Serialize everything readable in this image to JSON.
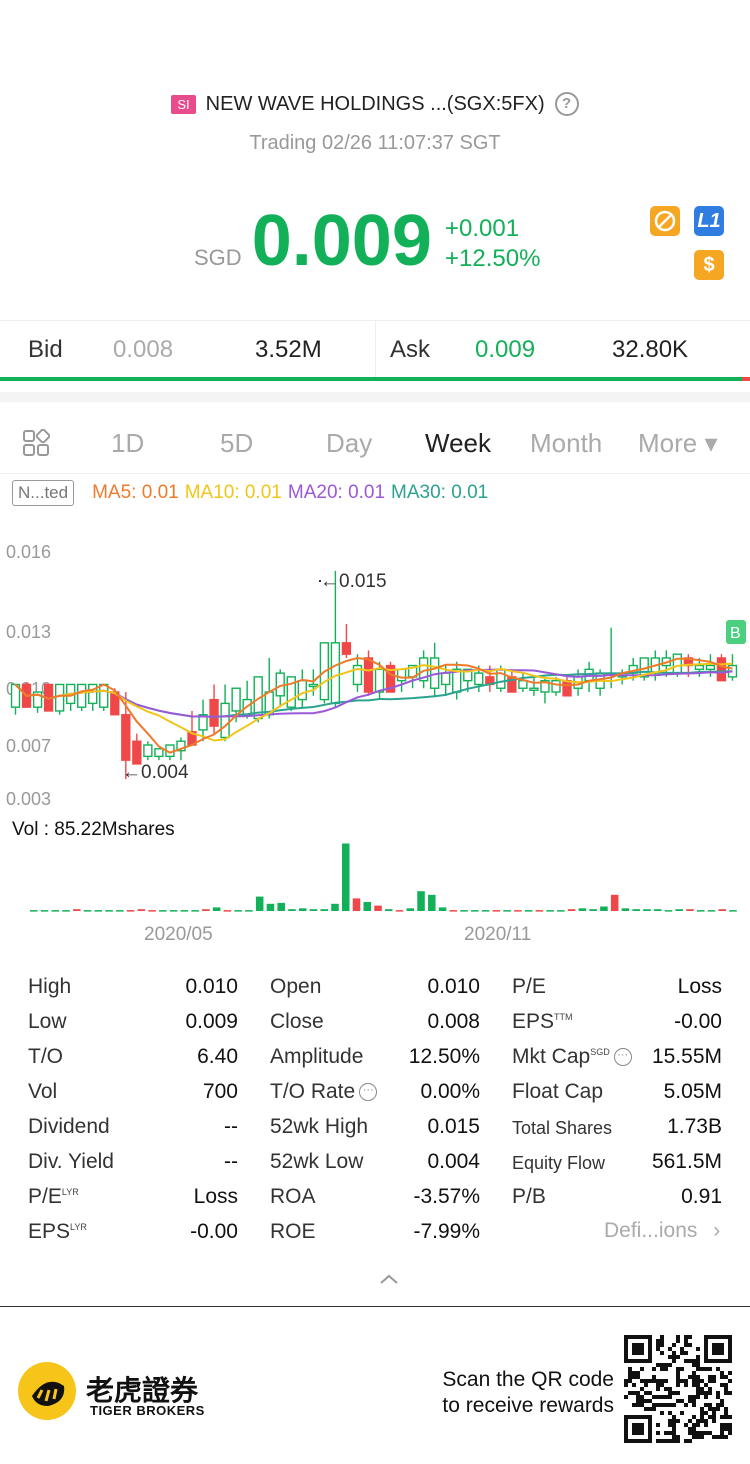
{
  "header": {
    "market_badge": "SI",
    "title": "NEW WAVE HOLDINGS ...(SGX:5FX)",
    "status": "Trading 02/26 11:07:37 SGT"
  },
  "quote": {
    "currency": "SGD",
    "price": "0.009",
    "change": "+0.001",
    "change_pct": "+12.50%",
    "badge_l1": "L1",
    "badge_s": "$"
  },
  "bidask": {
    "bid_label": "Bid",
    "bid_price": "0.008",
    "bid_size": "3.52M",
    "ask_label": "Ask",
    "ask_price": "0.009",
    "ask_size": "32.80K"
  },
  "tabs": [
    "1D",
    "5D",
    "Day",
    "Week",
    "Month",
    "More ▾"
  ],
  "active_tab": "Week",
  "indicators": {
    "adjust": "N...ted",
    "ma5": "MA5: 0.01",
    "ma10": "MA10: 0.01",
    "ma20": "MA20: 0.01",
    "ma30": "MA30: 0.01"
  },
  "colors": {
    "up": "#12b058",
    "down": "#f04848",
    "ma5": "#f07a2a",
    "ma10": "#f2c418",
    "ma20": "#9b59d8",
    "ma30": "#2aa38f"
  },
  "chart_data": {
    "type": "candlestick",
    "y_ticks": [
      "0.016",
      "0.013",
      "0.010",
      "0.007",
      "0.003"
    ],
    "annotations": [
      "←0.015",
      "←0.004"
    ],
    "volume_label": "Vol  : 85.22Mshares",
    "x_ticks": [
      "2020/05",
      "2020/11"
    ],
    "marker": "B"
  },
  "stats": {
    "col1": [
      {
        "label": "High",
        "value": "0.010"
      },
      {
        "label": "Low",
        "value": "0.009"
      },
      {
        "label": "T/O",
        "value": "6.40"
      },
      {
        "label": "Vol",
        "value": "700"
      },
      {
        "label": "Dividend",
        "value": "--"
      },
      {
        "label": "Div. Yield",
        "value": "--"
      },
      {
        "label": "P/E",
        "value": "Loss",
        "sup": "LYR"
      },
      {
        "label": "EPS",
        "value": "-0.00",
        "sup": "LYR"
      }
    ],
    "col2": [
      {
        "label": "Open",
        "value": "0.010"
      },
      {
        "label": "Close",
        "value": "0.008"
      },
      {
        "label": "Amplitude",
        "value": "12.50%"
      },
      {
        "label": "T/O Rate",
        "value": "0.00%"
      },
      {
        "label": "52wk High",
        "value": "0.015"
      },
      {
        "label": "52wk Low",
        "value": "0.004"
      },
      {
        "label": "ROA",
        "value": "-3.57%"
      },
      {
        "label": "ROE",
        "value": "-7.99%"
      }
    ],
    "col3": [
      {
        "label": "P/E",
        "value": "Loss"
      },
      {
        "label": "EPS",
        "value": "-0.00",
        "sup": "TTM"
      },
      {
        "label": "Mkt Cap",
        "value": "15.55M",
        "sup": "SGD"
      },
      {
        "label": "Float Cap",
        "value": "5.05M"
      },
      {
        "label": "Total Shares",
        "value": "1.73B"
      },
      {
        "label": "Equity Flow",
        "value": "561.5M"
      },
      {
        "label": "P/B",
        "value": "0.91"
      }
    ],
    "definitions": "Defi...ions"
  },
  "footer": {
    "brand_cn": "老虎證券",
    "brand_en": "TIGER BROKERS",
    "scan_line1": "Scan the QR code",
    "scan_line2": "to receive rewards"
  }
}
